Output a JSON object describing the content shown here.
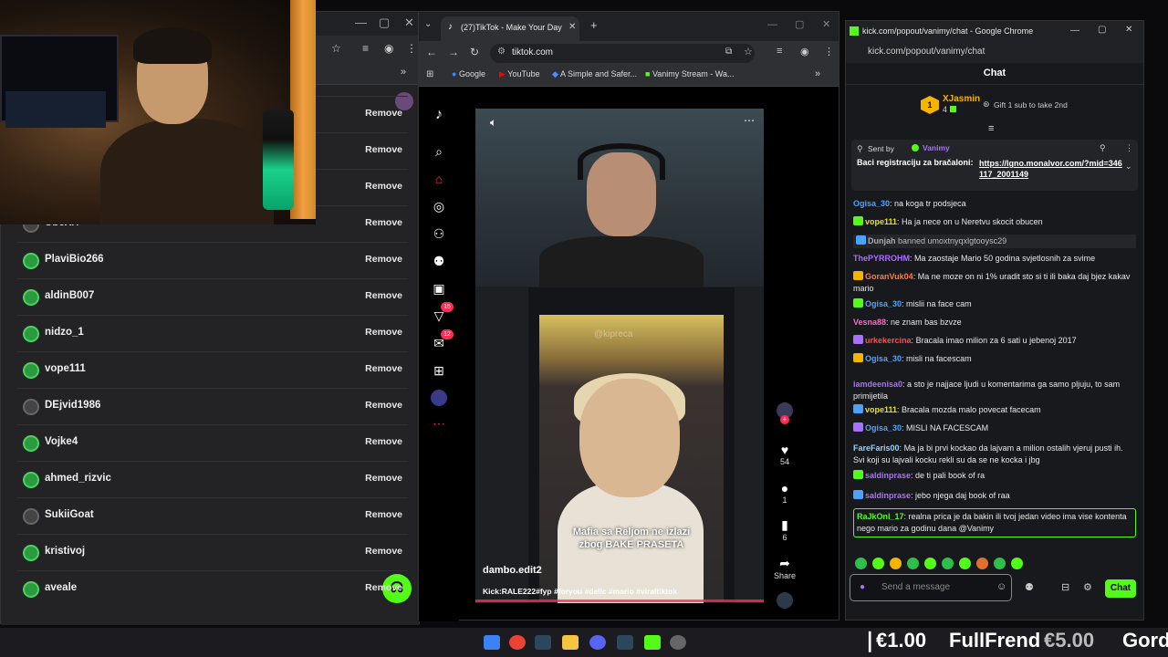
{
  "left_window": {
    "controls": [
      "—",
      "▢",
      "✕"
    ],
    "follow_rows": [
      {
        "name": "",
        "action": "Remove",
        "avatar": "green"
      },
      {
        "name": "",
        "action": "Remove",
        "avatar": "green"
      },
      {
        "name": "",
        "action": "Remove",
        "avatar": "green"
      },
      {
        "name": "UbeXX",
        "action": "Remove",
        "avatar": "dark"
      },
      {
        "name": "PlaviBio266",
        "action": "Remove",
        "avatar": "green"
      },
      {
        "name": "aldinB007",
        "action": "Remove",
        "avatar": "green"
      },
      {
        "name": "nidzo_1",
        "action": "Remove",
        "avatar": "green"
      },
      {
        "name": "vope111",
        "action": "Remove",
        "avatar": "green"
      },
      {
        "name": "DEjvid1986",
        "action": "Remove",
        "avatar": "dark"
      },
      {
        "name": "Vojke4",
        "action": "Remove",
        "avatar": "green"
      },
      {
        "name": "ahmed_rizvic",
        "action": "Remove",
        "avatar": "green"
      },
      {
        "name": "SukiiGoat",
        "action": "Remove",
        "avatar": "dark"
      },
      {
        "name": "kristivoj",
        "action": "Remove",
        "avatar": "green"
      },
      {
        "name": "aveale",
        "action": "Remove",
        "avatar": "green"
      }
    ]
  },
  "tiktok_window": {
    "tab_title": "(27)TikTok - Make Your Day",
    "url": "tiktok.com",
    "bookmarks": [
      "Google",
      "YouTube",
      "A Simple and Safer...",
      "Vanimy Stream - Wa..."
    ],
    "sidebar_badges": {
      "activity": "15",
      "messages": "12"
    },
    "video": {
      "overlay_handle": "@kipreca",
      "caption_line1": "Mafia sa Reljom ne izlazi",
      "caption_line2": "zbog BAKE PRASETA",
      "author": "dambo.edit2",
      "description": "Kick:RALE222#fyp #foryou #delic #mario #viraltiktok"
    },
    "actions": {
      "likes": "54",
      "comments": "1",
      "saves": "6",
      "share": "Share"
    }
  },
  "chat_window": {
    "title": "kick.com/popout/vanimy/chat - Google Chrome",
    "url": "kick.com/popout/vanimy/chat",
    "header": "Chat",
    "gift": {
      "rank": "1",
      "user": "XJasmin",
      "count": "4",
      "text": "Gift 1 sub to take 2nd"
    },
    "pinned": {
      "sent_by": "Sent by",
      "sender": "Vanimy",
      "text": "Baci registraciju za bračaloni:",
      "link": "https://lgno.monalvor.com/?mid=346117_2001149"
    },
    "messages": [
      {
        "user": "Ogisa_30",
        "color": "#4aa3ff",
        "text": "na koga tr podsjeca"
      },
      {
        "user": "vope111",
        "color": "#e6e600",
        "text": "Ha ja nece on u Neretvu skocit obucen"
      },
      {
        "user": "Dunjah",
        "color": "#aaaaaa",
        "text": "banned umoxtnyqxlgtooysc29",
        "system": true
      },
      {
        "user": "ThePYRROHM",
        "color": "#a970ff",
        "text": "Ma zaostaje Mario 50 godina svjetlosnih za svime"
      },
      {
        "user": "GoranVuk04",
        "color": "#ff7a3d",
        "text": "Ma ne moze on ni 1% uradit sto si ti ili baka daj bjez kakav mario"
      },
      {
        "user": "Ogisa_30",
        "color": "#4aa3ff",
        "text": "mislii na face cam"
      },
      {
        "user": "Vesna88",
        "color": "#ff66cc",
        "text": "ne znam bas bzvze"
      },
      {
        "user": "urkekercina",
        "color": "#ff4d4d",
        "text": "Bracala imao milion za 6 sati u jebenoj 2017"
      },
      {
        "user": "Ogisa_30",
        "color": "#4aa3ff",
        "text": "misli na facescam"
      },
      {
        "user": "iamdeenisa0",
        "color": "#a970ff",
        "text": "a sto je najjace ljudi u komentarima ga samo pljuju, to sam primijetila"
      },
      {
        "user": "vope111",
        "color": "#e6e600",
        "text": "Bracala mozda malo povecat facecam"
      },
      {
        "user": "Ogisa_30",
        "color": "#4aa3ff",
        "text": "MISLI NA FACESCAM"
      },
      {
        "user": "FareFaris00",
        "color": "#8fd3ff",
        "text": "Ma ja bi prvi kockao da lajvam a milion ostalih vjeruj pusti ih. Svi koji su lajvali kocku rekli su da se ne kocka i jbg"
      },
      {
        "user": "saldinprase",
        "color": "#a970ff",
        "text": "de ti pali book of ra"
      },
      {
        "user": "saldinprase",
        "color": "#a970ff",
        "text": "jebo njega daj book of raa"
      },
      {
        "user": "RaJkOnl_17",
        "color": "#53fc18",
        "text": "realna prica je da bakin ili tvoj jedan video ima vise kontenta nego mario za godinu dana @Vanimy"
      }
    ],
    "input_placeholder": "Send a message",
    "send_label": "Chat"
  },
  "taskbar": {
    "ticker": [
      "€1.00",
      "FullFrend",
      "€5.00",
      "Gord"
    ]
  },
  "colors": {
    "kick_green": "#53fc18",
    "tiktok_red": "#fe2c55"
  }
}
